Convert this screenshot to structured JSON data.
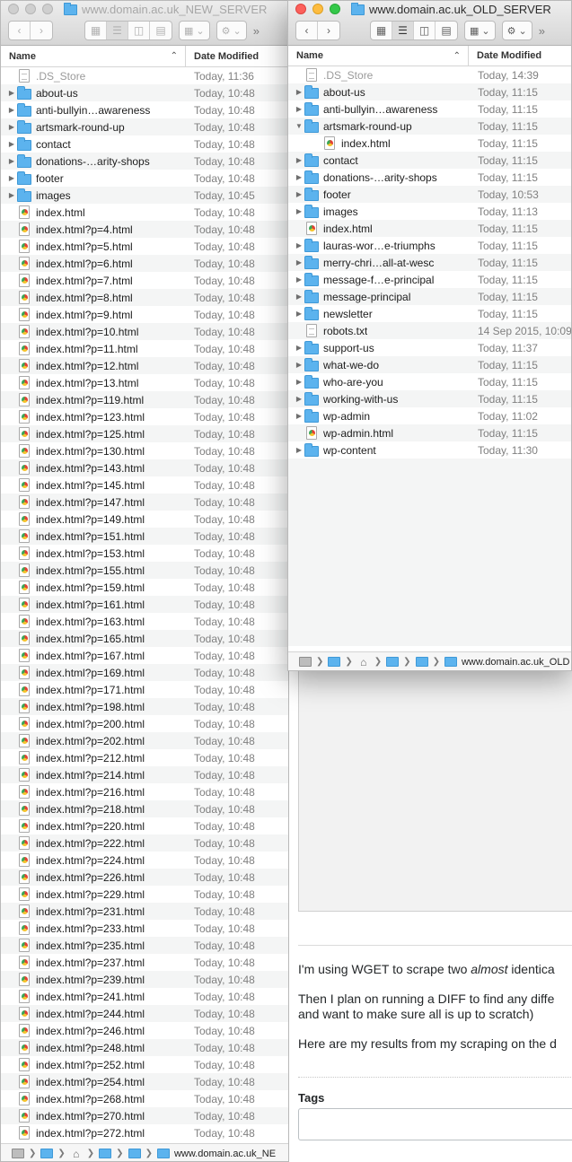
{
  "new_window": {
    "title": "www.domain.ac.uk_NEW_SERVER",
    "header": {
      "name": "Name",
      "date": "Date Modified"
    },
    "rows": [
      {
        "name": ".DS_Store",
        "date": "Today, 11:36",
        "kind": "file",
        "dim": true
      },
      {
        "name": "about-us",
        "date": "Today, 10:48",
        "kind": "folder"
      },
      {
        "name": "anti-bullyin…awareness",
        "date": "Today, 10:48",
        "kind": "folder"
      },
      {
        "name": "artsmark-round-up",
        "date": "Today, 10:48",
        "kind": "folder"
      },
      {
        "name": "contact",
        "date": "Today, 10:48",
        "kind": "folder"
      },
      {
        "name": "donations-…arity-shops",
        "date": "Today, 10:48",
        "kind": "folder"
      },
      {
        "name": "footer",
        "date": "Today, 10:48",
        "kind": "folder"
      },
      {
        "name": "images",
        "date": "Today, 10:45",
        "kind": "folder"
      },
      {
        "name": "index.html",
        "date": "Today, 10:48",
        "kind": "html"
      },
      {
        "name": "index.html?p=4.html",
        "date": "Today, 10:48",
        "kind": "html"
      },
      {
        "name": "index.html?p=5.html",
        "date": "Today, 10:48",
        "kind": "html"
      },
      {
        "name": "index.html?p=6.html",
        "date": "Today, 10:48",
        "kind": "html"
      },
      {
        "name": "index.html?p=7.html",
        "date": "Today, 10:48",
        "kind": "html"
      },
      {
        "name": "index.html?p=8.html",
        "date": "Today, 10:48",
        "kind": "html"
      },
      {
        "name": "index.html?p=9.html",
        "date": "Today, 10:48",
        "kind": "html"
      },
      {
        "name": "index.html?p=10.html",
        "date": "Today, 10:48",
        "kind": "html"
      },
      {
        "name": "index.html?p=11.html",
        "date": "Today, 10:48",
        "kind": "html"
      },
      {
        "name": "index.html?p=12.html",
        "date": "Today, 10:48",
        "kind": "html"
      },
      {
        "name": "index.html?p=13.html",
        "date": "Today, 10:48",
        "kind": "html"
      },
      {
        "name": "index.html?p=119.html",
        "date": "Today, 10:48",
        "kind": "html"
      },
      {
        "name": "index.html?p=123.html",
        "date": "Today, 10:48",
        "kind": "html"
      },
      {
        "name": "index.html?p=125.html",
        "date": "Today, 10:48",
        "kind": "html"
      },
      {
        "name": "index.html?p=130.html",
        "date": "Today, 10:48",
        "kind": "html"
      },
      {
        "name": "index.html?p=143.html",
        "date": "Today, 10:48",
        "kind": "html"
      },
      {
        "name": "index.html?p=145.html",
        "date": "Today, 10:48",
        "kind": "html"
      },
      {
        "name": "index.html?p=147.html",
        "date": "Today, 10:48",
        "kind": "html"
      },
      {
        "name": "index.html?p=149.html",
        "date": "Today, 10:48",
        "kind": "html"
      },
      {
        "name": "index.html?p=151.html",
        "date": "Today, 10:48",
        "kind": "html"
      },
      {
        "name": "index.html?p=153.html",
        "date": "Today, 10:48",
        "kind": "html"
      },
      {
        "name": "index.html?p=155.html",
        "date": "Today, 10:48",
        "kind": "html"
      },
      {
        "name": "index.html?p=159.html",
        "date": "Today, 10:48",
        "kind": "html"
      },
      {
        "name": "index.html?p=161.html",
        "date": "Today, 10:48",
        "kind": "html"
      },
      {
        "name": "index.html?p=163.html",
        "date": "Today, 10:48",
        "kind": "html"
      },
      {
        "name": "index.html?p=165.html",
        "date": "Today, 10:48",
        "kind": "html"
      },
      {
        "name": "index.html?p=167.html",
        "date": "Today, 10:48",
        "kind": "html"
      },
      {
        "name": "index.html?p=169.html",
        "date": "Today, 10:48",
        "kind": "html"
      },
      {
        "name": "index.html?p=171.html",
        "date": "Today, 10:48",
        "kind": "html"
      },
      {
        "name": "index.html?p=198.html",
        "date": "Today, 10:48",
        "kind": "html"
      },
      {
        "name": "index.html?p=200.html",
        "date": "Today, 10:48",
        "kind": "html"
      },
      {
        "name": "index.html?p=202.html",
        "date": "Today, 10:48",
        "kind": "html"
      },
      {
        "name": "index.html?p=212.html",
        "date": "Today, 10:48",
        "kind": "html"
      },
      {
        "name": "index.html?p=214.html",
        "date": "Today, 10:48",
        "kind": "html"
      },
      {
        "name": "index.html?p=216.html",
        "date": "Today, 10:48",
        "kind": "html"
      },
      {
        "name": "index.html?p=218.html",
        "date": "Today, 10:48",
        "kind": "html"
      },
      {
        "name": "index.html?p=220.html",
        "date": "Today, 10:48",
        "kind": "html"
      },
      {
        "name": "index.html?p=222.html",
        "date": "Today, 10:48",
        "kind": "html"
      },
      {
        "name": "index.html?p=224.html",
        "date": "Today, 10:48",
        "kind": "html"
      },
      {
        "name": "index.html?p=226.html",
        "date": "Today, 10:48",
        "kind": "html"
      },
      {
        "name": "index.html?p=229.html",
        "date": "Today, 10:48",
        "kind": "html"
      },
      {
        "name": "index.html?p=231.html",
        "date": "Today, 10:48",
        "kind": "html"
      },
      {
        "name": "index.html?p=233.html",
        "date": "Today, 10:48",
        "kind": "html"
      },
      {
        "name": "index.html?p=235.html",
        "date": "Today, 10:48",
        "kind": "html"
      },
      {
        "name": "index.html?p=237.html",
        "date": "Today, 10:48",
        "kind": "html"
      },
      {
        "name": "index.html?p=239.html",
        "date": "Today, 10:48",
        "kind": "html"
      },
      {
        "name": "index.html?p=241.html",
        "date": "Today, 10:48",
        "kind": "html"
      },
      {
        "name": "index.html?p=244.html",
        "date": "Today, 10:48",
        "kind": "html"
      },
      {
        "name": "index.html?p=246.html",
        "date": "Today, 10:48",
        "kind": "html"
      },
      {
        "name": "index.html?p=248.html",
        "date": "Today, 10:48",
        "kind": "html"
      },
      {
        "name": "index.html?p=252.html",
        "date": "Today, 10:48",
        "kind": "html"
      },
      {
        "name": "index.html?p=254.html",
        "date": "Today, 10:48",
        "kind": "html"
      },
      {
        "name": "index.html?p=268.html",
        "date": "Today, 10:48",
        "kind": "html"
      },
      {
        "name": "index.html?p=270.html",
        "date": "Today, 10:48",
        "kind": "html"
      },
      {
        "name": "index.html?p=272.html",
        "date": "Today, 10:48",
        "kind": "html"
      }
    ],
    "pathbar_label": "www.domain.ac.uk_NE"
  },
  "old_window": {
    "title": "www.domain.ac.uk_OLD_SERVER",
    "header": {
      "name": "Name",
      "date": "Date Modified"
    },
    "rows": [
      {
        "name": ".DS_Store",
        "date": "Today, 14:39",
        "kind": "file",
        "dim": true
      },
      {
        "name": "about-us",
        "date": "Today, 11:15",
        "kind": "folder"
      },
      {
        "name": "anti-bullyin…awareness",
        "date": "Today, 11:15",
        "kind": "folder"
      },
      {
        "name": "artsmark-round-up",
        "date": "Today, 11:15",
        "kind": "folder",
        "expanded": true
      },
      {
        "name": "index.html",
        "date": "Today, 11:15",
        "kind": "html",
        "child": true
      },
      {
        "name": "contact",
        "date": "Today, 11:15",
        "kind": "folder"
      },
      {
        "name": "donations-…arity-shops",
        "date": "Today, 11:15",
        "kind": "folder"
      },
      {
        "name": "footer",
        "date": "Today, 10:53",
        "kind": "folder"
      },
      {
        "name": "images",
        "date": "Today, 11:13",
        "kind": "folder"
      },
      {
        "name": "index.html",
        "date": "Today, 11:15",
        "kind": "html"
      },
      {
        "name": "lauras-wor…e-triumphs",
        "date": "Today, 11:15",
        "kind": "folder"
      },
      {
        "name": "merry-chri…all-at-wesc",
        "date": "Today, 11:15",
        "kind": "folder"
      },
      {
        "name": "message-f…e-principal",
        "date": "Today, 11:15",
        "kind": "folder"
      },
      {
        "name": "message-principal",
        "date": "Today, 11:15",
        "kind": "folder"
      },
      {
        "name": "newsletter",
        "date": "Today, 11:15",
        "kind": "folder"
      },
      {
        "name": "robots.txt",
        "date": "14 Sep 2015, 10:09",
        "kind": "text"
      },
      {
        "name": "support-us",
        "date": "Today, 11:37",
        "kind": "folder"
      },
      {
        "name": "what-we-do",
        "date": "Today, 11:15",
        "kind": "folder"
      },
      {
        "name": "who-are-you",
        "date": "Today, 11:15",
        "kind": "folder"
      },
      {
        "name": "working-with-us",
        "date": "Today, 11:15",
        "kind": "folder"
      },
      {
        "name": "wp-admin",
        "date": "Today, 11:02",
        "kind": "folder"
      },
      {
        "name": "wp-admin.html",
        "date": "Today, 11:15",
        "kind": "html"
      },
      {
        "name": "wp-content",
        "date": "Today, 11:30",
        "kind": "folder"
      }
    ],
    "pathbar_label": "www.domain.ac.uk_OLD"
  },
  "background_page": {
    "para1_a": "I'm using WGET to scrape two ",
    "para1_em": "almost",
    "para1_b": " identica",
    "para2_l1": "Then I plan on running a DIFF to find any diffe",
    "para2_l2": "and want to make sure all is up to scratch)",
    "para3": "Here are my results from my scraping on the d",
    "tags_label": "Tags"
  },
  "icons": {
    "back": "chevron-left-icon",
    "forward": "chevron-right-icon",
    "gear": "gear-icon",
    "more": "double-chevron-right-icon"
  }
}
